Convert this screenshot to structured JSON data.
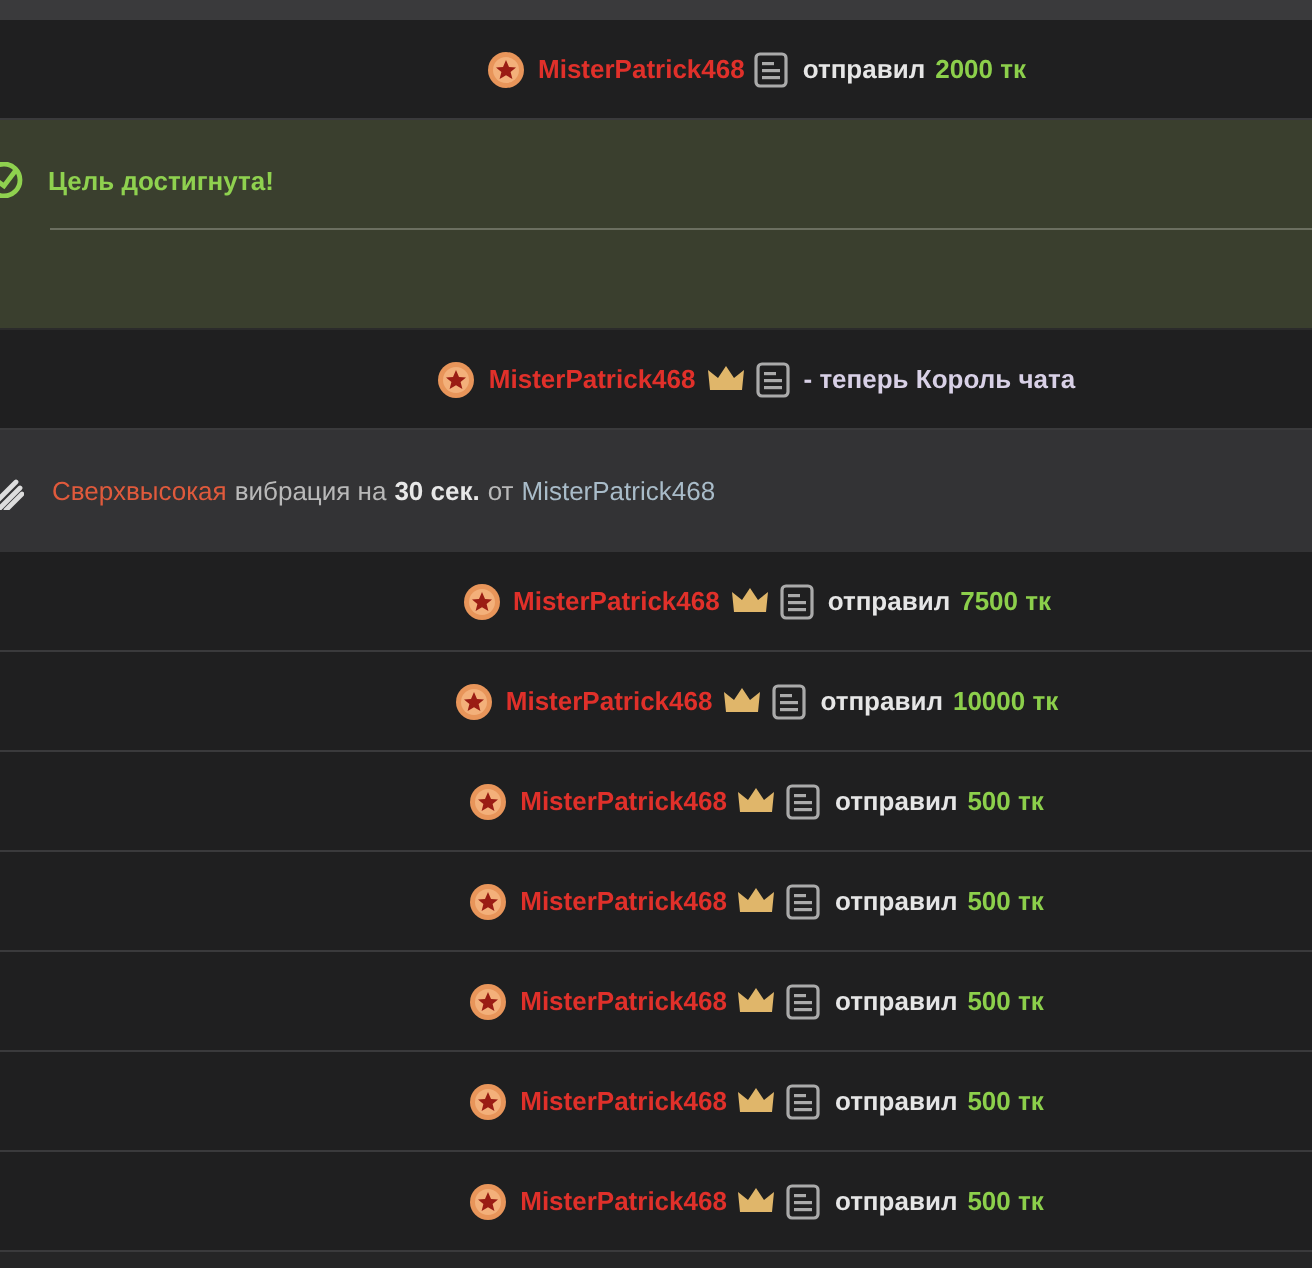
{
  "messages": [
    {
      "kind": "tip",
      "user": "MisterPatrick468",
      "crown": false,
      "action": "отправил",
      "amount": "2000 тк"
    },
    {
      "kind": "goal",
      "text": "Цель достигнута!"
    },
    {
      "kind": "king",
      "user": "MisterPatrick468",
      "crown": true,
      "text": "- теперь Король чата"
    },
    {
      "kind": "vibration",
      "intensity": "Сверхвысокая",
      "text": "вибрация на",
      "duration": "30 сек.",
      "from": "от",
      "sender": "MisterPatrick468"
    },
    {
      "kind": "tip",
      "user": "MisterPatrick468",
      "crown": true,
      "action": "отправил",
      "amount": "7500 тк"
    },
    {
      "kind": "tip",
      "user": "MisterPatrick468",
      "crown": true,
      "action": "отправил",
      "amount": "10000 тк"
    },
    {
      "kind": "tip",
      "user": "MisterPatrick468",
      "crown": true,
      "action": "отправил",
      "amount": "500 тк"
    },
    {
      "kind": "tip",
      "user": "MisterPatrick468",
      "crown": true,
      "action": "отправил",
      "amount": "500 тк"
    },
    {
      "kind": "tip",
      "user": "MisterPatrick468",
      "crown": true,
      "action": "отправил",
      "amount": "500 тк"
    },
    {
      "kind": "tip",
      "user": "MisterPatrick468",
      "crown": true,
      "action": "отправил",
      "amount": "500 тк"
    },
    {
      "kind": "tip",
      "user": "MisterPatrick468",
      "crown": true,
      "action": "отправил",
      "amount": "500 тк"
    }
  ]
}
